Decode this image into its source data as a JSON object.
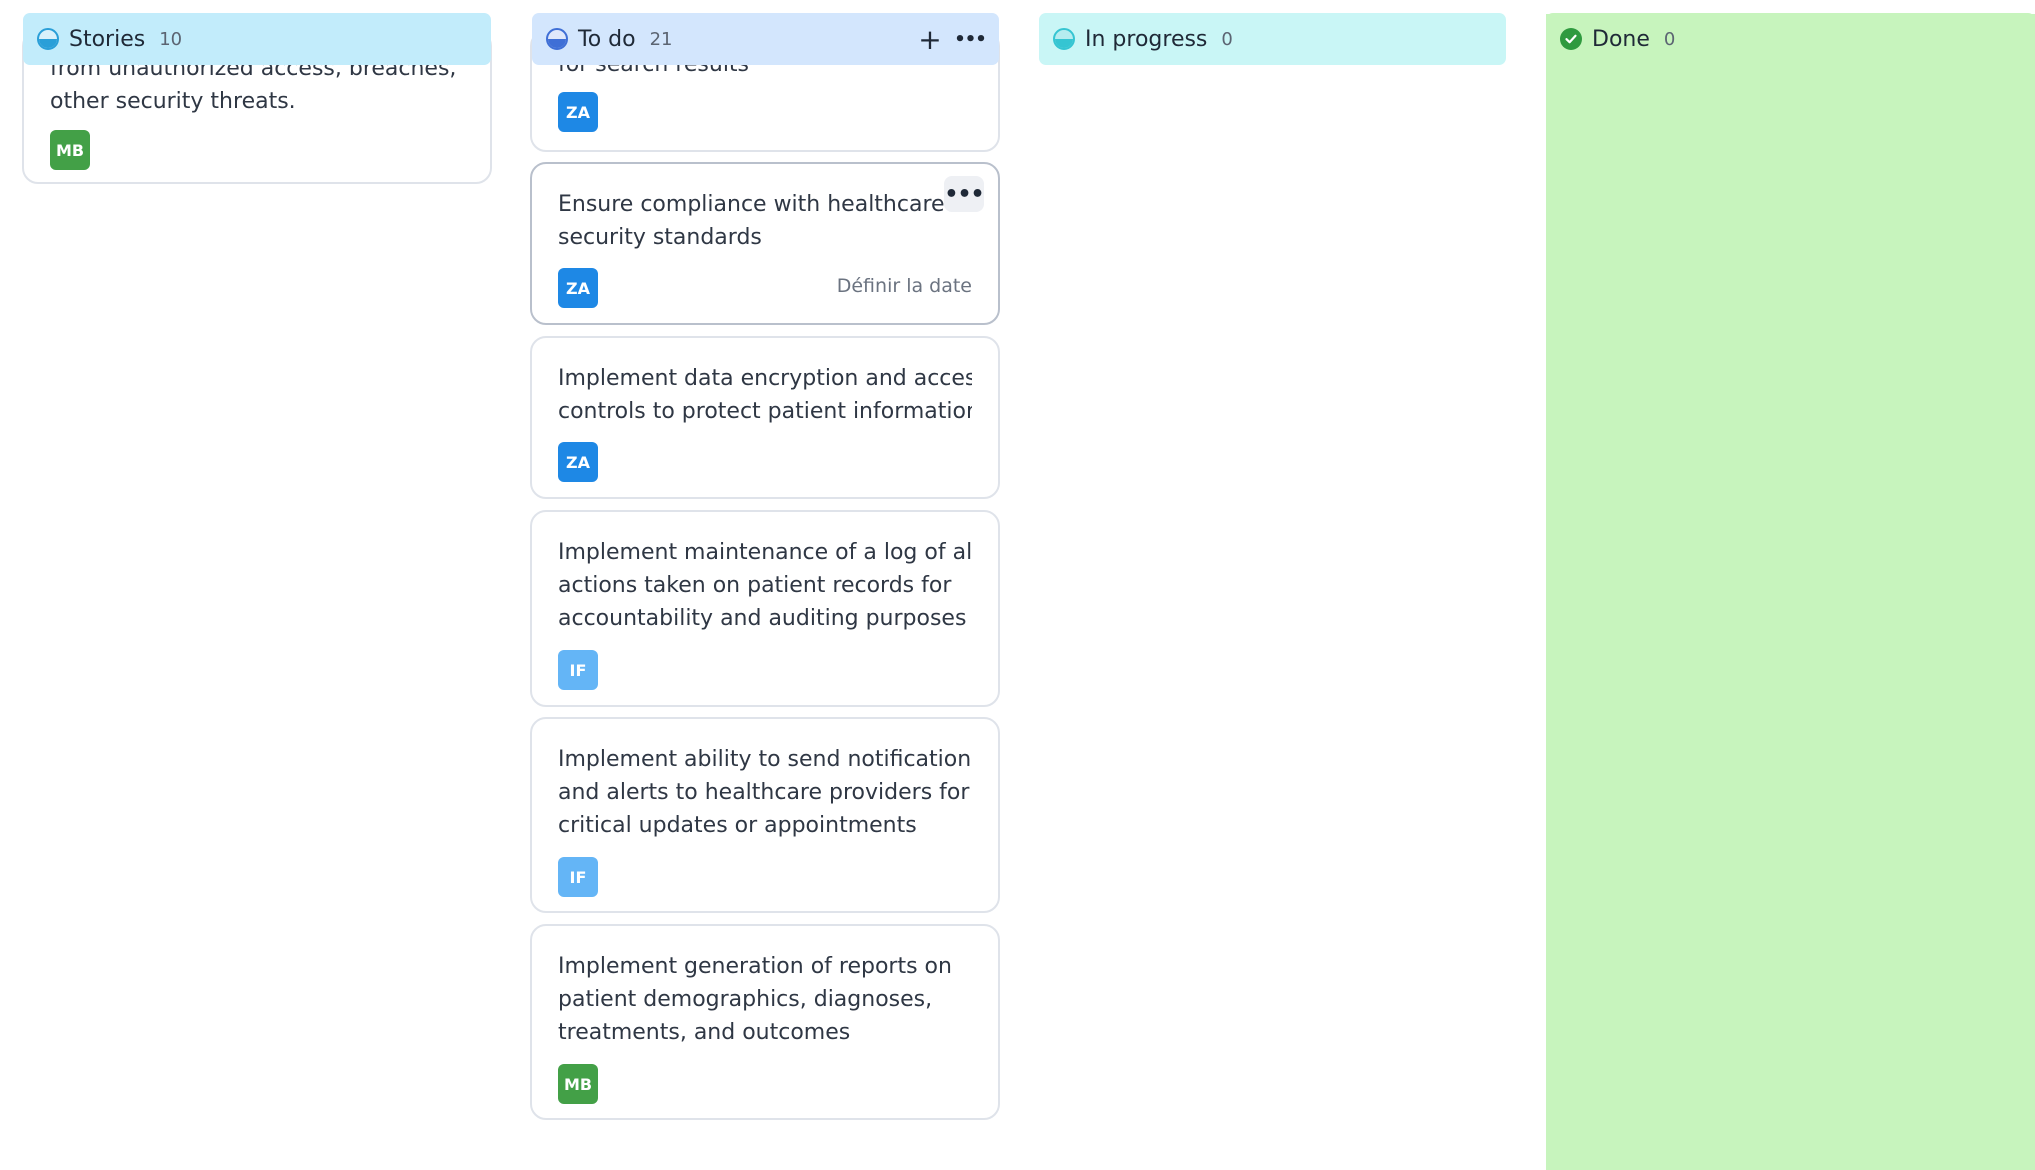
{
  "columns": {
    "stories": {
      "title": "Stories",
      "count": "10",
      "bg": "#c2ecfb",
      "icon_color": "#2a9fd8"
    },
    "todo": {
      "title": "To do",
      "count": "21",
      "bg": "#d3e6fd",
      "icon_color": "#3f6fd6",
      "add_icon": "+",
      "more_icon": "•••"
    },
    "in_progress": {
      "title": "In progress",
      "count": "0",
      "bg": "#c9f6f6",
      "icon_color": "#35c5d2"
    },
    "done": {
      "title": "Done",
      "count": "0",
      "bg": "#c7f4bd",
      "icon_color": "#2f9a3f"
    }
  },
  "stories_cards": [
    {
      "lines": [
        "from unauthorized access, breaches, or",
        "other security threats."
      ],
      "avatar": "MB",
      "avatar_color": "#43a047"
    }
  ],
  "todo_cards": [
    {
      "lines": [
        "for search results"
      ],
      "avatar": "ZA",
      "avatar_color": "#1e88e5"
    },
    {
      "lines": [
        "Ensure compliance with healthcare data",
        "security standards"
      ],
      "avatar": "ZA",
      "avatar_color": "#1e88e5",
      "date_label": "Définir la date",
      "more_icon": "•••"
    },
    {
      "lines": [
        "Implement data encryption and access",
        "controls to protect patient information"
      ],
      "avatar": "ZA",
      "avatar_color": "#1e88e5"
    },
    {
      "lines": [
        "Implement maintenance of a log of all",
        "actions taken on patient records for",
        "accountability and auditing purposes"
      ],
      "avatar": "IF",
      "avatar_color": "#64b5f6"
    },
    {
      "lines": [
        "Implement ability to send notifications",
        "and alerts to healthcare providers for",
        "critical updates or appointments"
      ],
      "avatar": "IF",
      "avatar_color": "#64b5f6"
    },
    {
      "lines": [
        "Implement generation of reports on",
        "patient demographics, diagnoses,",
        "treatments, and outcomes"
      ],
      "avatar": "MB",
      "avatar_color": "#43a047"
    }
  ]
}
